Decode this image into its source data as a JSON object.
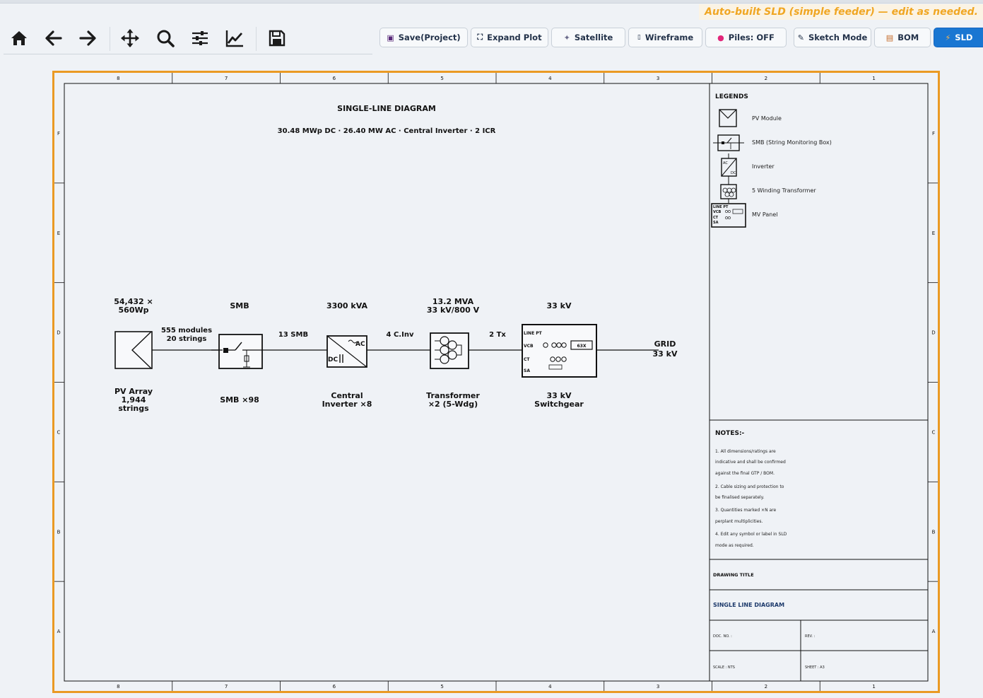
{
  "hint": "Auto-built SLD (simple feeder) — edit as needed.",
  "toolbar": {
    "nav_tools": [
      "home-icon",
      "back-arrow-icon",
      "forward-arrow-icon",
      "pan-icon",
      "zoom-icon",
      "sliders-icon",
      "line-chart-icon",
      "save-icon"
    ],
    "buttons": [
      {
        "label": "Save(Project)",
        "icon": "floppy-icon"
      },
      {
        "label": "Expand Plot",
        "icon": "expand-icon"
      },
      {
        "label": "Satellite",
        "icon": "satellite-icon"
      },
      {
        "label": "Wireframe",
        "icon": "wireframe-icon"
      },
      {
        "label": "Piles: OFF",
        "icon": "pin-icon"
      },
      {
        "label": "Sketch Mode",
        "icon": "pencil-icon"
      },
      {
        "label": "BOM",
        "icon": "clipboard-icon"
      },
      {
        "label": "SLD",
        "icon": "lightning-icon",
        "active": true
      }
    ]
  },
  "sheet": {
    "col_labels": [
      "8",
      "7",
      "6",
      "5",
      "4",
      "3",
      "2",
      "1"
    ],
    "row_labels": [
      "F",
      "E",
      "D",
      "C",
      "B",
      "A"
    ],
    "title": "SINGLE-LINE DIAGRAM",
    "subtitle": "30.48 MWp DC · 26.40 MW AC · Central Inverter · 2 ICR",
    "components": {
      "pv": {
        "top1": "54,432 ×",
        "top2": "560Wp",
        "bot1": "PV Array",
        "bot2": "1,944",
        "bot3": "strings"
      },
      "smb": {
        "top": "SMB",
        "bot": "SMB ×98"
      },
      "inverter": {
        "top": "3300 kVA",
        "bot1": "Central",
        "bot2": "Inverter ×8",
        "ac": "AC",
        "dc": "DC"
      },
      "transformer": {
        "top1": "13.2 MVA",
        "top2": "33 kV/800 V",
        "bot1": "Transformer",
        "bot2": "×2 (5-Wdg)"
      },
      "switchgear": {
        "top": "33 kV",
        "bot1": "33 kV",
        "bot2": "Switchgear",
        "rows": [
          "LINE PT",
          "VCB",
          "CT",
          "SA"
        ],
        "breaker": "63X"
      }
    },
    "links": {
      "pv_smb1": "555 modules",
      "pv_smb2": "20 strings",
      "smb_inv": "13 SMB",
      "inv_tx": "4 C.Inv",
      "tx_sg": "2 Tx"
    },
    "grid": {
      "line1": "GRID",
      "line2": "33 kV"
    },
    "legends": {
      "heading": "LEGENDS",
      "items": [
        {
          "label": "PV Module",
          "icon": "pv-module-symbol"
        },
        {
          "label": "SMB (String Monitoring Box)",
          "icon": "smb-symbol"
        },
        {
          "label": "Inverter",
          "icon": "inverter-symbol"
        },
        {
          "label": "5 Winding Transformer",
          "icon": "transformer-symbol"
        },
        {
          "label": "MV Panel",
          "icon": "mv-panel-symbol"
        }
      ],
      "mv_rows": [
        "LINE PT",
        "VCB",
        "CT",
        "SA"
      ]
    },
    "notes": {
      "heading": "NOTES:-",
      "lines": [
        "1. All dimensions/ratings are",
        "indicative and shall be confirmed",
        "against the final GTP / BOM.",
        "2. Cable sizing and protection to",
        "be finalised separately.",
        "3. Quantities marked ×N are",
        "perplant multiplicities.",
        "4. Edit any symbol or label in SLD",
        "mode as required."
      ]
    },
    "titleblock": {
      "drawing_title_label": "DRAWING TITLE",
      "drawing_title": "SINGLE LINE DIAGRAM",
      "doc_no": "DOC. NO. :",
      "rev": "REV. :",
      "scale": "SCALE : NTS",
      "sheet": "SHEET : A3"
    }
  }
}
